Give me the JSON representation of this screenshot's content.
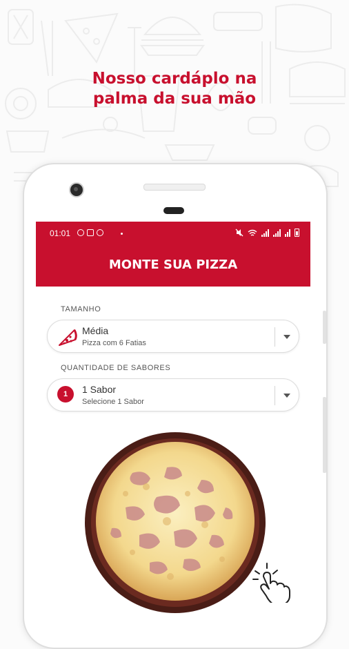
{
  "promo": {
    "line1": "Nosso cardáplo na",
    "line2": "palma da sua mão"
  },
  "status_bar": {
    "time": "01:01"
  },
  "app": {
    "title": "MONTE SUA PIZZA",
    "size_section": {
      "label": "TAMANHO",
      "selected_value": "Média",
      "selected_detail": "Pizza com 6 Fatias",
      "icon": "pizza-slice-icon"
    },
    "flavors_section": {
      "label": "QUANTIDADE DE SABORES",
      "badge": "1",
      "selected_value": "1 Sabor",
      "selected_detail": "Selecione 1 Sabor"
    }
  },
  "colors": {
    "brand": "#c8102e",
    "background": "#fbfbfb"
  }
}
